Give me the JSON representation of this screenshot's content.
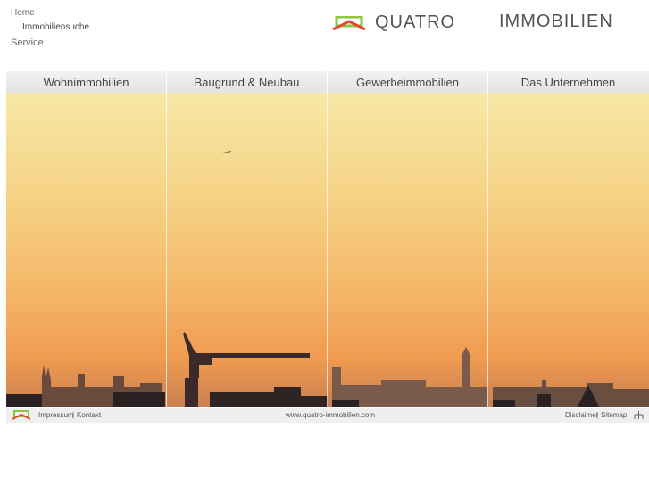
{
  "top_nav": {
    "home": "Home",
    "search": "Immobiliensuche",
    "service": "Service"
  },
  "brand": {
    "name1": "QUATRO",
    "name2": "IMMOBILIEN",
    "accent": "#8cc63f",
    "accent2": "#e8482a"
  },
  "menu": [
    "Wohnimmobilien",
    "Baugrund & Neubau",
    "Gewerbeimmobilien",
    "Das Unternehmen"
  ],
  "footer": {
    "impressum": "Impressum",
    "kontakt": "Kontakt",
    "sep": "|",
    "url": "www.quatro-immobilien.com",
    "disclaimer": "Disclaimer",
    "sitemap": "Sitemap"
  }
}
